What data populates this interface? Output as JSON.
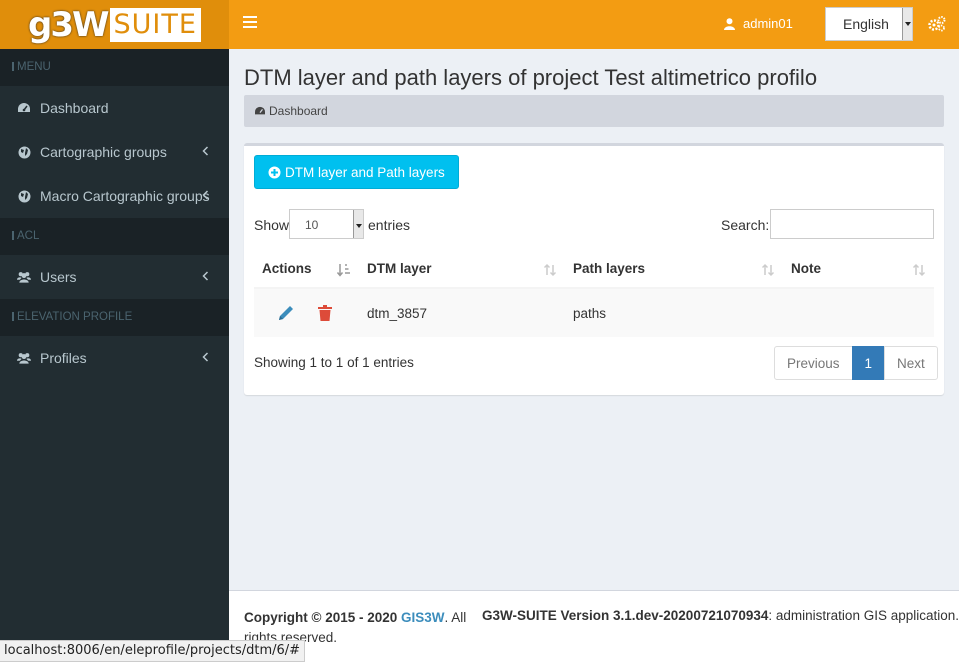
{
  "header": {
    "logo_main": "g3W",
    "logo_suite": "SUITE",
    "username": "admin01",
    "language": "English"
  },
  "sidebar": {
    "sections": [
      {
        "title": "MENU"
      },
      {
        "title": "ACL"
      },
      {
        "title": "ELEVATION PROFILE"
      }
    ],
    "items": [
      {
        "label": "Dashboard",
        "icon": "dashboard-icon"
      },
      {
        "label": "Cartographic groups",
        "icon": "globe-icon"
      },
      {
        "label": "Macro Cartographic groups",
        "icon": "globe-icon"
      },
      {
        "label": "Users",
        "icon": "users-icon"
      },
      {
        "label": "Profiles",
        "icon": "users-icon"
      }
    ]
  },
  "page": {
    "title": "DTM layer and path layers of project Test altimetrico profilo",
    "breadcrumb": "Dashboard"
  },
  "box": {
    "add_button": "DTM layer and Path layers",
    "show_label": "Show",
    "page_size": "10",
    "entries_label": "entries",
    "search_label": "Search:",
    "search_value": "",
    "columns": [
      "Actions",
      "DTM layer",
      "Path layers",
      "Note"
    ],
    "rows": [
      {
        "dtm": "dtm_3857",
        "paths": "paths",
        "note": ""
      }
    ],
    "info": "Showing 1 to 1 of 1 entries",
    "pager": {
      "previous": "Previous",
      "current": "1",
      "next": "Next"
    }
  },
  "footer": {
    "copyright": "Copyright © 2015 - 2020",
    "company": "GIS3W",
    "rights": ". All rights reserved.",
    "version": "G3W-SUITE Version 3.1.dev-20200721070934",
    "description": ": administration GIS application."
  },
  "status_bar": {
    "url": "localhost:8006/en/eleprofile/projects/dtm/6/#"
  },
  "colors": {
    "header": "#f39c12",
    "logo_bg": "#e08e0b",
    "sidebar": "#222d32",
    "add_button": "#00c0ef",
    "pager_active": "#337ab7",
    "edit": "#3c8dbc",
    "delete": "#dd4b39"
  }
}
